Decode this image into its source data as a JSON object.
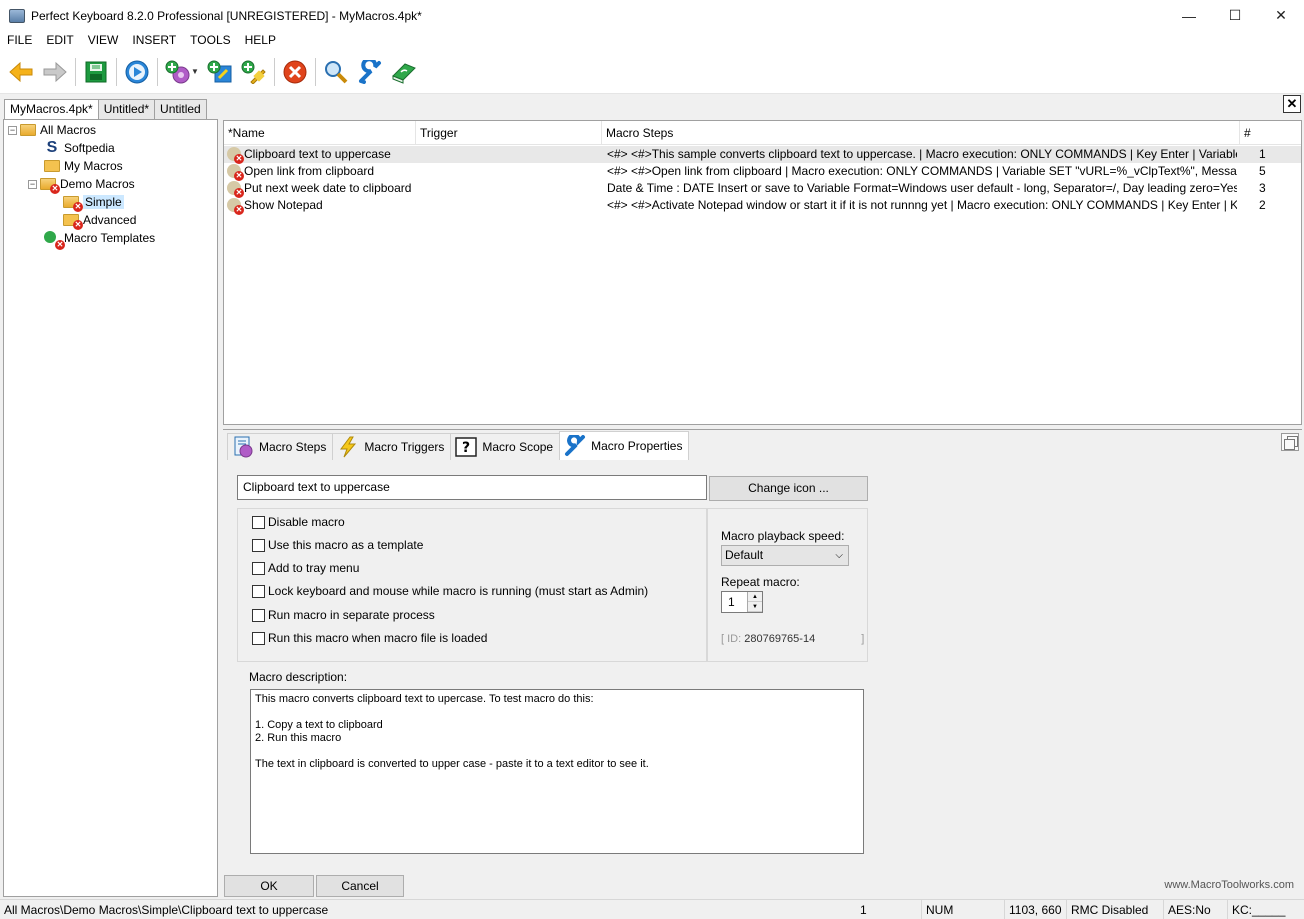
{
  "window": {
    "title": "Perfect Keyboard 8.2.0 Professional [UNREGISTERED] - MyMacros.4pk*",
    "minimize": "—",
    "maximize": "☐",
    "close": "✕"
  },
  "menu": [
    "FILE",
    "EDIT",
    "VIEW",
    "INSERT",
    "TOOLS",
    "HELP"
  ],
  "file_tabs": [
    "MyMacros.4pk*",
    "Untitled*",
    "Untitled"
  ],
  "tree": {
    "items": [
      "All Macros",
      "Softpedia",
      "My Macros",
      "Demo Macros",
      "Simple",
      "Advanced",
      "Macro Templates"
    ],
    "expand_minus": "−"
  },
  "grid": {
    "columns": [
      "*Name",
      "Trigger",
      "Macro Steps",
      "#"
    ],
    "rows": [
      {
        "name": "Clipboard text to uppercase",
        "trigger": "",
        "steps": "<#> <#>This sample converts clipboard text to uppercase. | Macro execution: ONLY COMMANDS | Key Enter | Variable OPERATI...",
        "count": "1"
      },
      {
        "name": "Open link from clipboard",
        "trigger": "",
        "steps": "<#> <#>Open link from clipboard | Macro execution: ONLY COMMANDS | Variable SET \"vURL=%_vClpText%\", Message text=\"<n...",
        "count": "5"
      },
      {
        "name": "Put next week date to clipboard",
        "trigger": "",
        "steps": "Date & Time : DATE Insert or save to Variable Format=Windows user default - long, Separator=/, Day leading zero=Yes, Month lea...",
        "count": "3"
      },
      {
        "name": "Show Notepad",
        "trigger": "",
        "steps": "<#> <#>Activate Notepad window or start it if it is not runnng yet | Macro execution: ONLY COMMANDS | Key Enter | Key Enter | IF...",
        "count": "2"
      }
    ]
  },
  "panel_tabs": [
    "Macro Steps",
    "Macro Triggers",
    "Macro Scope",
    "Macro Properties"
  ],
  "properties": {
    "macro_name": "Clipboard text to uppercase",
    "change_icon": "Change icon ...",
    "options": [
      "Disable macro",
      "Use this macro as a template",
      "Add to tray menu",
      "Lock keyboard and mouse while macro is running (must start as Admin)",
      "Run macro in separate process",
      "Run this macro when macro file is loaded"
    ],
    "speed_label": "Macro playback speed:",
    "speed_value": "Default",
    "repeat_label": "Repeat macro:",
    "repeat_value": "1",
    "id_prefix": "[ ID: ",
    "id_value": "280769765-14",
    "id_suffix": "]",
    "description_label": "Macro description:",
    "description": "This macro converts clipboard text to upercase. To test macro do this:\n\n1. Copy a text to clipboard\n2. Run this macro\n\nThe text in clipboard is converted to upper case - paste it to a text editor to see it."
  },
  "buttons": {
    "ok": "OK",
    "cancel": "Cancel"
  },
  "website": "www.MacroToolworks.com",
  "status": {
    "path": "All Macros\\Demo Macros\\Simple\\Clipboard text to uppercase",
    "count": "1",
    "num": "NUM",
    "coords": "1103, 660",
    "rmc": "RMC Disabled",
    "aes": "AES:No",
    "kc": "KC:_____"
  },
  "icons": [
    "back-icon",
    "forward-icon",
    "save-icon",
    "play-icon",
    "add-macro-icon",
    "add-text-icon",
    "add-sample-icon",
    "delete-icon",
    "search-icon",
    "settings-wrench-icon",
    "help-book-icon"
  ],
  "colors": {
    "selection": "#cce8ff",
    "delete_red": "#d9261c",
    "accent_blue": "#1a73c9",
    "folder": "#f4c24f"
  }
}
